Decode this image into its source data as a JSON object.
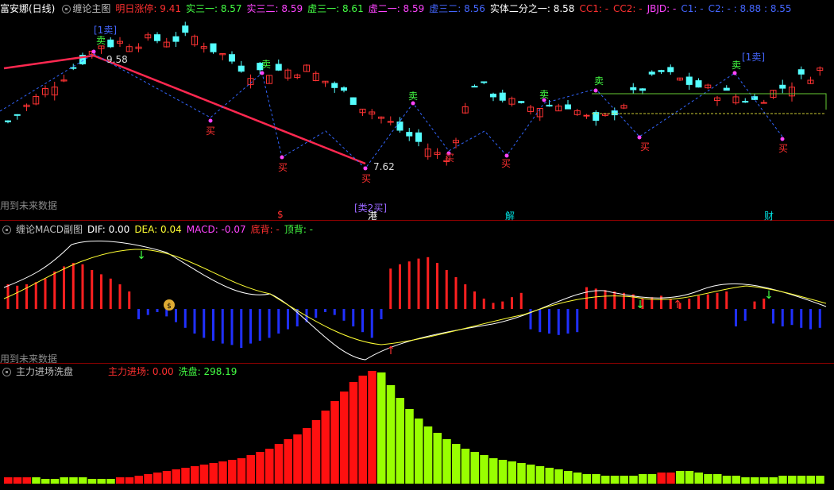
{
  "panel1": {
    "stock": "富安娜(日线)",
    "indicator": "缠论主图",
    "fields": [
      {
        "label": "明日涨停: 9.41",
        "color": "#ff3030"
      },
      {
        "label": "实三一: 8.57",
        "color": "#44ff44"
      },
      {
        "label": "实三二: 8.59",
        "color": "#ff44ff"
      },
      {
        "label": "虚三一: 8.61",
        "color": "#44ff44"
      },
      {
        "label": "虚二一: 8.59",
        "color": "#ff44ff"
      },
      {
        "label": "虚三二: 8.56",
        "color": "#4466ff"
      },
      {
        "label": "实体二分之一: 8.58",
        "color": "#ffffff"
      },
      {
        "label": "CC1: -",
        "color": "#ff3030"
      },
      {
        "label": "CC2: -",
        "color": "#ff3030"
      },
      {
        "label": "JBJD: -",
        "color": "#ff44ff"
      },
      {
        "label": "C1: -",
        "color": "#4466ff"
      },
      {
        "label": "C2: - : 8.88 : 8.55",
        "color": "#4466ff"
      }
    ],
    "future_note": "用到未来数据",
    "high_label": "9.58",
    "low_label": "7.62",
    "sell_label": "卖",
    "buy_label": "买",
    "sell1_label": "[1卖]",
    "buy2_label": "[类2买]",
    "events": [
      {
        "text": "$",
        "color": "#ff3030"
      },
      {
        "text": "港",
        "color": "#ffffff"
      },
      {
        "text": "解",
        "color": "#00e0e0"
      },
      {
        "text": "财",
        "color": "#00e0e0"
      }
    ]
  },
  "panel2": {
    "indicator": "缠论MACD副图",
    "fields": [
      {
        "label": "DIF: 0.00",
        "color": "#ffffff"
      },
      {
        "label": "DEA: 0.04",
        "color": "#ffff33"
      },
      {
        "label": "MACD: -0.07",
        "color": "#ff44ff"
      },
      {
        "label": "底背: -",
        "color": "#ff3030"
      },
      {
        "label": "顶背: -",
        "color": "#44ff44"
      }
    ],
    "future_note": "用到未来数据"
  },
  "panel3": {
    "indicator": "主力进场洗盘",
    "fields": [
      {
        "label": "主力进场: 0.00",
        "color": "#ff3030"
      },
      {
        "label": "洗盘: 298.19",
        "color": "#44ff44"
      }
    ]
  },
  "colors": {
    "up": "#ff3333",
    "down": "#55ffff",
    "macd_pos": "#ff2020",
    "macd_neg": "#2030ff",
    "inflow": "#ff1010",
    "wash": "#99ff00"
  }
}
